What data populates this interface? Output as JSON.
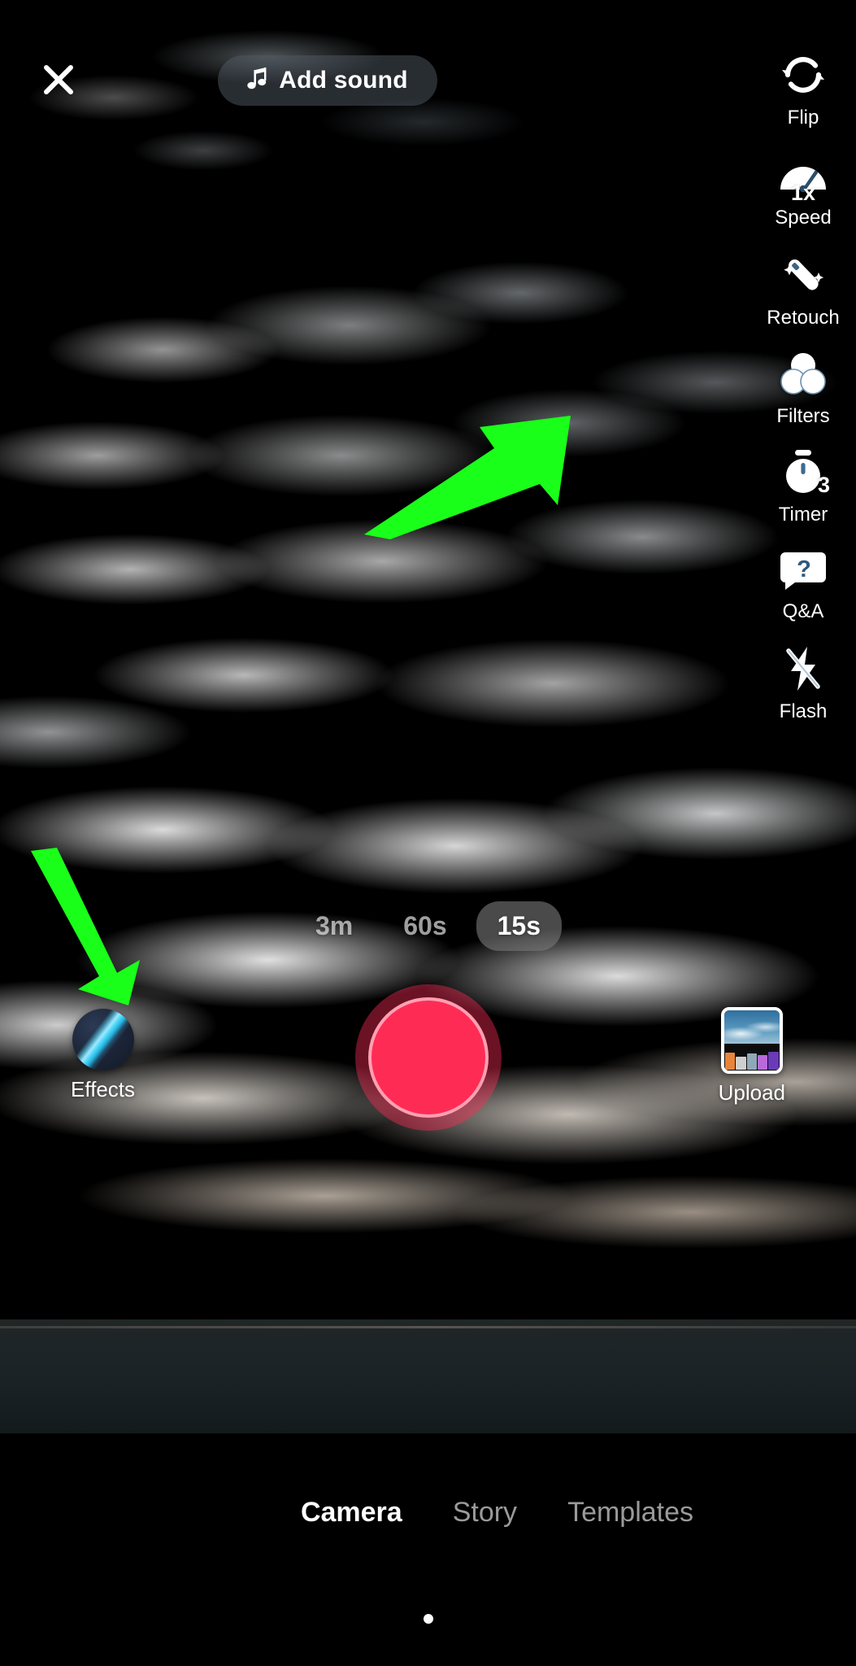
{
  "app": {
    "screen": "camera",
    "accent_record": "#fe2c55",
    "annotation_color": "#1aff1a"
  },
  "topbar": {
    "close_icon": "close-x-icon",
    "sound": {
      "icon": "music-note-icon",
      "label": "Add sound"
    }
  },
  "rail": {
    "items": [
      {
        "key": "flip",
        "icon": "camera-flip-icon",
        "label": "Flip"
      },
      {
        "key": "speed",
        "icon": "speedometer-icon",
        "label": "Speed",
        "value": "1x"
      },
      {
        "key": "retouch",
        "icon": "magic-wand-icon",
        "label": "Retouch"
      },
      {
        "key": "filters",
        "icon": "filters-circles-icon",
        "label": "Filters"
      },
      {
        "key": "timer",
        "icon": "stopwatch-icon",
        "label": "Timer",
        "value": "3"
      },
      {
        "key": "qa",
        "icon": "question-bubble-icon",
        "label": "Q&A"
      },
      {
        "key": "flash",
        "icon": "flash-off-icon",
        "label": "Flash"
      }
    ]
  },
  "annotations": [
    {
      "name": "arrow-to-filters",
      "direction": "up-right",
      "points_at": "Filters"
    },
    {
      "name": "arrow-to-effects",
      "direction": "down-left",
      "points_at": "Effects"
    }
  ],
  "durations": {
    "options": [
      {
        "label": "3m",
        "selected": false
      },
      {
        "label": "60s",
        "selected": false
      },
      {
        "label": "15s",
        "selected": true
      }
    ],
    "selected": "15s"
  },
  "controls": {
    "effects": {
      "icon": "effects-orb-icon",
      "label": "Effects"
    },
    "record": {
      "icon": "record-button-icon",
      "label": ""
    },
    "upload": {
      "icon": "gallery-thumbnail-icon",
      "label": "Upload"
    }
  },
  "tabbar": {
    "tabs": [
      {
        "label": "Camera",
        "active": true
      },
      {
        "label": "Story",
        "active": false
      },
      {
        "label": "Templates",
        "active": false
      }
    ]
  }
}
